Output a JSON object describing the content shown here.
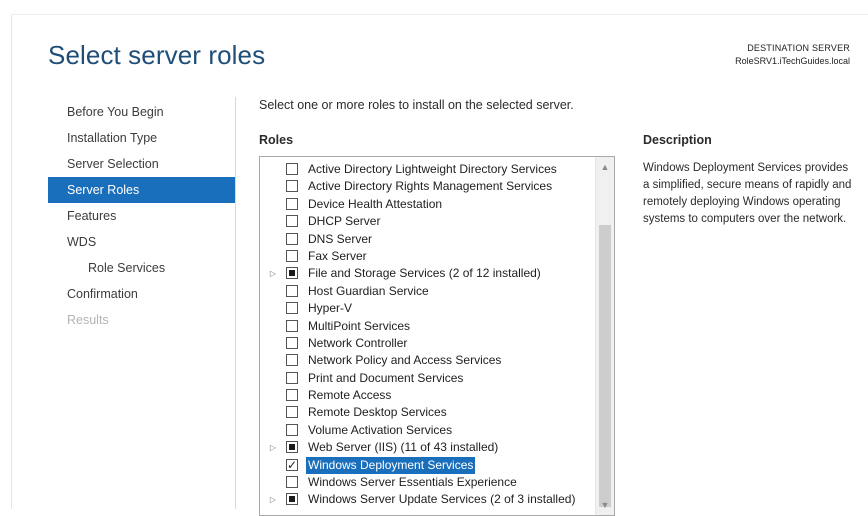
{
  "header": {
    "title": "Select server roles",
    "destination_label": "DESTINATION SERVER",
    "destination_server": "RoleSRV1.iTechGuides.local"
  },
  "nav": {
    "items": [
      {
        "label": "Before You Begin",
        "state": "normal"
      },
      {
        "label": "Installation Type",
        "state": "normal"
      },
      {
        "label": "Server Selection",
        "state": "normal"
      },
      {
        "label": "Server Roles",
        "state": "active"
      },
      {
        "label": "Features",
        "state": "normal"
      },
      {
        "label": "WDS",
        "state": "normal"
      },
      {
        "label": "Role Services",
        "state": "sub"
      },
      {
        "label": "Confirmation",
        "state": "normal"
      },
      {
        "label": "Results",
        "state": "disabled"
      }
    ]
  },
  "main": {
    "instruction": "Select one or more roles to install on the selected server.",
    "roles_heading": "Roles",
    "roles": [
      {
        "label": "Active Directory Lightweight Directory Services",
        "state": "unchecked",
        "expandable": false
      },
      {
        "label": "Active Directory Rights Management Services",
        "state": "unchecked",
        "expandable": false
      },
      {
        "label": "Device Health Attestation",
        "state": "unchecked",
        "expandable": false
      },
      {
        "label": "DHCP Server",
        "state": "unchecked",
        "expandable": false
      },
      {
        "label": "DNS Server",
        "state": "unchecked",
        "expandable": false
      },
      {
        "label": "Fax Server",
        "state": "unchecked",
        "expandable": false
      },
      {
        "label": "File and Storage Services (2 of 12 installed)",
        "state": "indeterminate",
        "expandable": true
      },
      {
        "label": "Host Guardian Service",
        "state": "unchecked",
        "expandable": false
      },
      {
        "label": "Hyper-V",
        "state": "unchecked",
        "expandable": false
      },
      {
        "label": "MultiPoint Services",
        "state": "unchecked",
        "expandable": false
      },
      {
        "label": "Network Controller",
        "state": "unchecked",
        "expandable": false
      },
      {
        "label": "Network Policy and Access Services",
        "state": "unchecked",
        "expandable": false
      },
      {
        "label": "Print and Document Services",
        "state": "unchecked",
        "expandable": false
      },
      {
        "label": "Remote Access",
        "state": "unchecked",
        "expandable": false
      },
      {
        "label": "Remote Desktop Services",
        "state": "unchecked",
        "expandable": false
      },
      {
        "label": "Volume Activation Services",
        "state": "unchecked",
        "expandable": false
      },
      {
        "label": "Web Server (IIS) (11 of 43 installed)",
        "state": "indeterminate",
        "expandable": true
      },
      {
        "label": "Windows Deployment Services",
        "state": "checked",
        "expandable": false,
        "selected": true
      },
      {
        "label": "Windows Server Essentials Experience",
        "state": "unchecked",
        "expandable": false
      },
      {
        "label": "Windows Server Update Services (2 of 3 installed)",
        "state": "indeterminate",
        "expandable": true
      }
    ]
  },
  "description": {
    "heading": "Description",
    "text": "Windows Deployment Services provides a simplified, secure means of rapidly and remotely deploying Windows operating systems to computers over the network."
  },
  "icons": {
    "expander": "triangle-right-icon",
    "scroll_up": "chevron-up-icon",
    "scroll_down": "chevron-down-icon",
    "check": "checkmark-icon"
  },
  "colors": {
    "title": "#1f4e79",
    "accent": "#1a6fbd"
  }
}
